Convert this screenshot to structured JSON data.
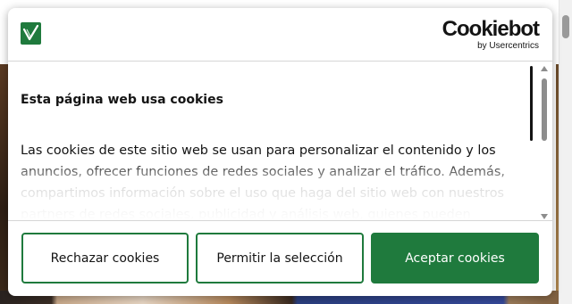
{
  "dialog": {
    "title": "Esta página web usa cookies",
    "body": "Las cookies de este sitio web se usan para personalizar el contenido y los anuncios, ofrecer funciones de redes sociales y analizar el tráfico. Además, compartimos información sobre el uso que haga del sitio web con nuestros partners de redes sociales, publicidad y análisis web, quienes pueden combinarla con otra información que les haya proporcionado o que hayan recopilado a partir del uso que haya hecho de sus servicios."
  },
  "provider": {
    "name": "Cookiebot",
    "by": "by Usercentrics"
  },
  "buttons": {
    "reject": "Rechazar cookies",
    "allow_selection": "Permitir la selección",
    "accept": "Aceptar cookies"
  },
  "icons": {
    "brand": "green-check-logo-icon",
    "scroll_up": "scroll-up-arrow-icon",
    "scroll_down": "scroll-down-arrow-icon"
  },
  "colors": {
    "accent": "#1f7a3d",
    "text": "#141414",
    "accept_text": "#ffffff"
  }
}
